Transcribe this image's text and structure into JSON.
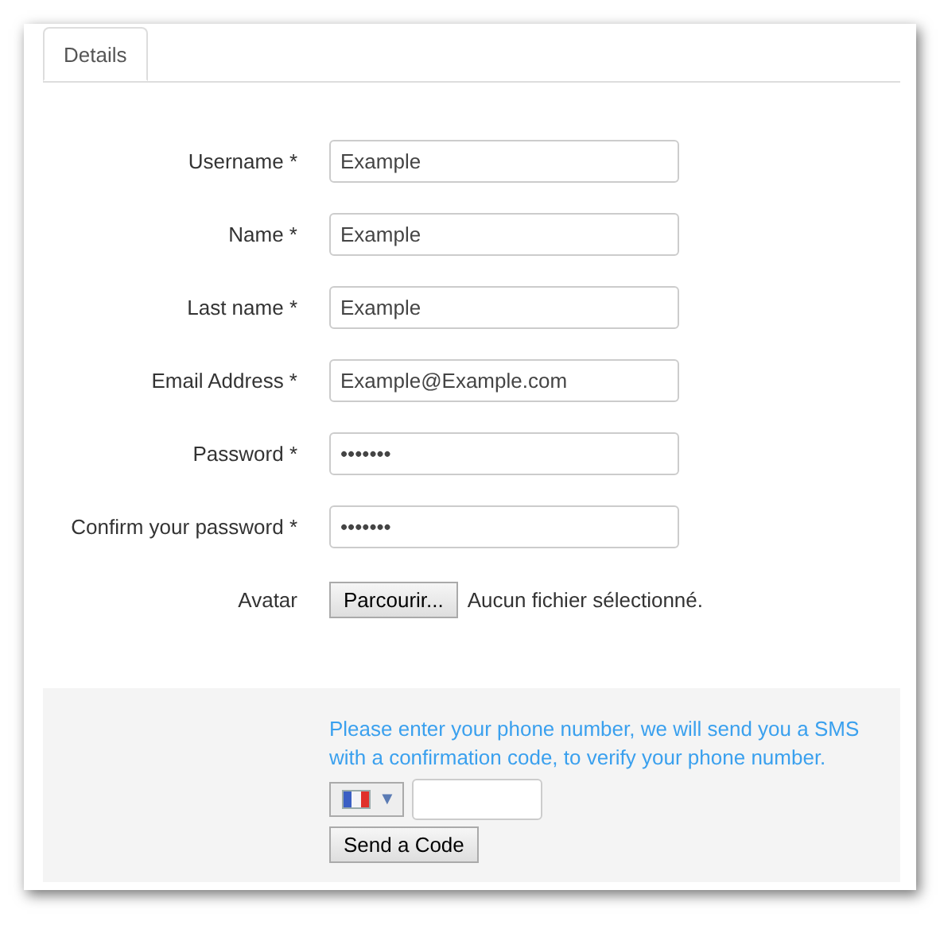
{
  "tabs": [
    {
      "label": "Details",
      "selected": true
    }
  ],
  "fields": [
    {
      "label": "Username *",
      "value": "Example"
    },
    {
      "label": "Name *",
      "value": "Example"
    },
    {
      "label": "Last name *",
      "value": "Example"
    },
    {
      "label": "Email Address *",
      "value": "Example@Example.com"
    },
    {
      "label": "Password *",
      "value": "•••••••"
    },
    {
      "label": "Confirm your password *",
      "value": "•••••••"
    }
  ],
  "avatar": {
    "label": "Avatar",
    "button": "Parcourir...",
    "status": "Aucun fichier sélectionné."
  },
  "phone": {
    "message": "Please enter your phone number, we will send you a SMS with a confirmation code, to verify your phone number.",
    "country_arrow": "▼",
    "button": "Send a Code"
  }
}
